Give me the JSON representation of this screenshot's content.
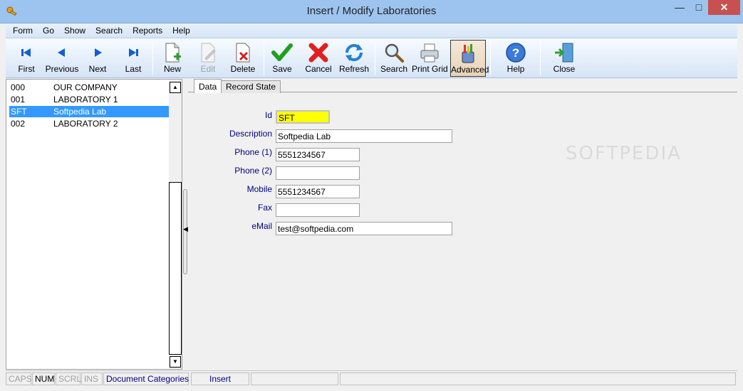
{
  "window": {
    "title": "Insert / Modify Laboratories",
    "min_glyph": "—",
    "max_glyph": "□",
    "close_glyph": "✕"
  },
  "menu": [
    "Form",
    "Go",
    "Show",
    "Search",
    "Reports",
    "Help"
  ],
  "toolbar": {
    "first": "First",
    "previous": "Previous",
    "next": "Next",
    "last": "Last",
    "new": "New",
    "edit": "Edit",
    "delete": "Delete",
    "save": "Save",
    "cancel": "Cancel",
    "refresh": "Refresh",
    "search": "Search",
    "print_grid": "Print Grid",
    "advanced": "Advanced",
    "help": "Help",
    "close": "Close"
  },
  "list": {
    "rows": [
      {
        "code": "000",
        "name": "OUR COMPANY"
      },
      {
        "code": "001",
        "name": "LABORATORY 1"
      },
      {
        "code": "SFT",
        "name": "Softpedia Lab"
      },
      {
        "code": "002",
        "name": "LABORATORY 2"
      }
    ],
    "selected_index": 2
  },
  "tabs": {
    "data": "Data",
    "record_state": "Record State"
  },
  "form": {
    "id_label": "Id",
    "id_value": "SFT",
    "description_label": "Description",
    "description_value": "Softpedia Lab",
    "phone1_label": "Phone (1)",
    "phone1_value": "5551234567",
    "phone2_label": "Phone (2)",
    "phone2_value": "",
    "mobile_label": "Mobile",
    "mobile_value": "5551234567",
    "fax_label": "Fax",
    "fax_value": "",
    "email_label": "eMail",
    "email_value": "test@softpedia.com"
  },
  "watermark": "SOFTPEDIA",
  "status": {
    "caps": "CAPS",
    "num": "NUM",
    "scrl": "SCRL",
    "ins": "INS",
    "document": "Document Categories",
    "mode": "Insert"
  },
  "colors": {
    "accent": "#3399ff",
    "id_highlight": "#ffff00",
    "label": "#000080",
    "close": "#c75050"
  }
}
